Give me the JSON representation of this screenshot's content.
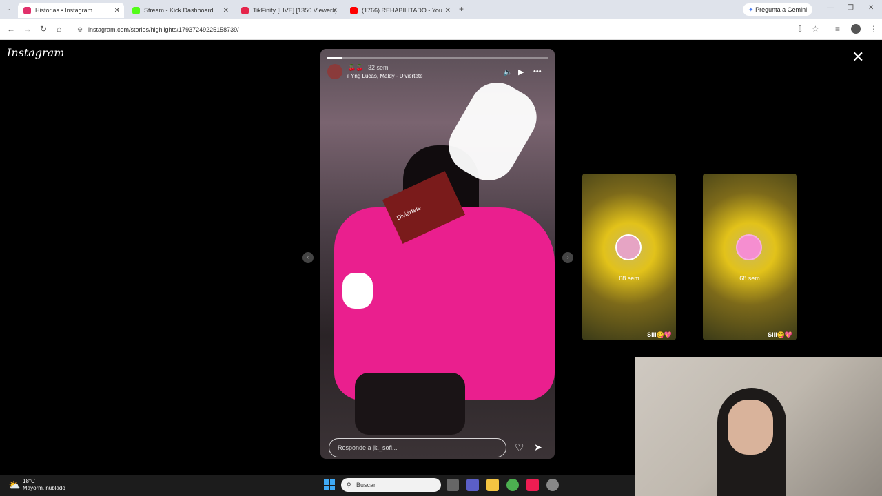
{
  "browser": {
    "tabs": [
      {
        "title": "Historias • Instagram",
        "color": "#e1306c"
      },
      {
        "title": "Stream - Kick Dashboard",
        "color": "#53fc18"
      },
      {
        "title": "TikFinity [LIVE] [1350 Viewers]",
        "color": "#e5254b"
      },
      {
        "title": "(1766) REHABILITADO - You",
        "color": "#ff0000"
      }
    ],
    "gemini": "Pregunta a Gemini",
    "url": "instagram.com/stories/highlights/17937249225158739/"
  },
  "instagram": {
    "logo": "Instagram",
    "story": {
      "progress": 0.07,
      "time": "32 sem",
      "song": "Yng Lucas, Maldy - Diviértete",
      "reply_placeholder": "Responde a jk._sofi...",
      "card_text": "Diviértete"
    },
    "thumbnails": [
      {
        "age": "68 sem",
        "caption": "Siii😋💖"
      },
      {
        "age": "68 sem",
        "caption": "Siii😋💖"
      }
    ]
  },
  "taskbar": {
    "temp": "18°C",
    "weather": "Mayorm. nublado",
    "search_placeholder": "Buscar"
  }
}
